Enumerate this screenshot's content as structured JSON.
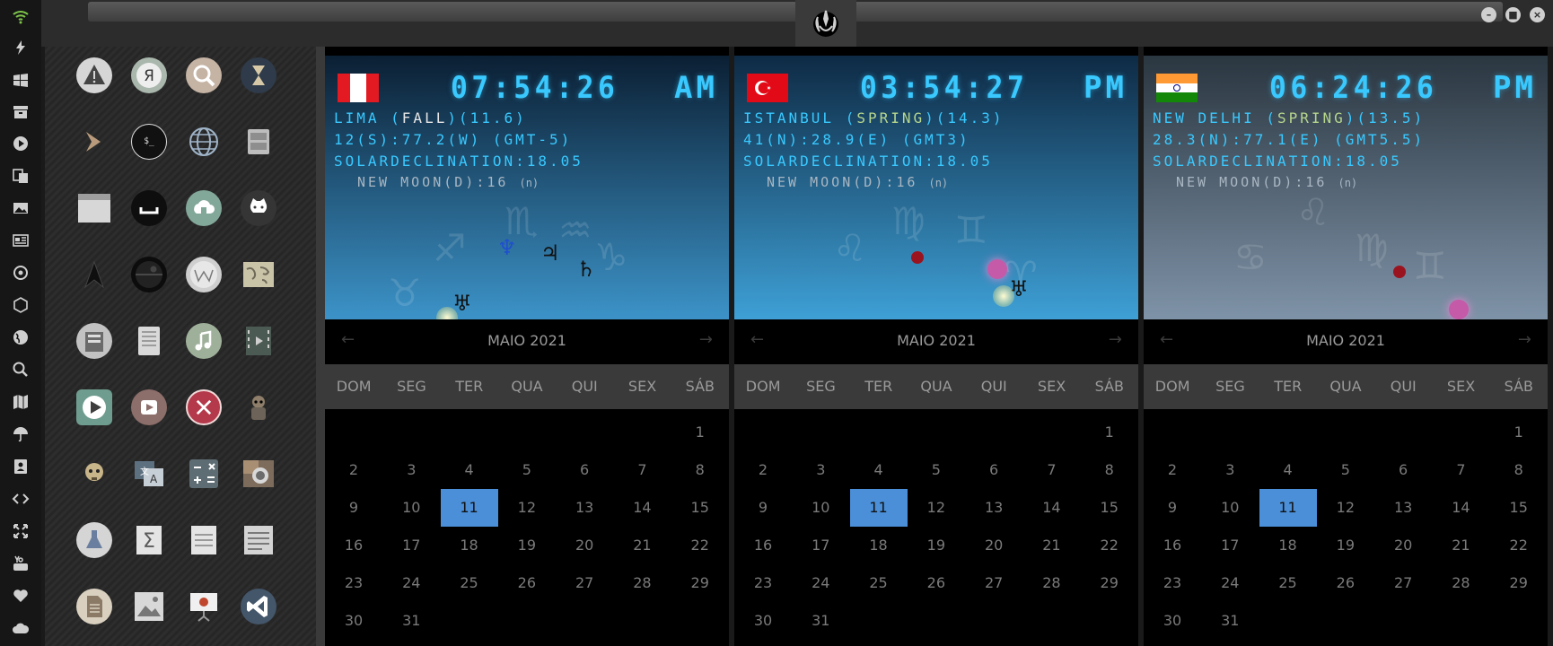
{
  "weekdays": [
    "DOM",
    "SEG",
    "TER",
    "QUA",
    "QUI",
    "SEX",
    "SÁB"
  ],
  "widgets": [
    {
      "clock": "07:54:26",
      "ampm": "AM",
      "line1": "LIMA (",
      "season": "FALL",
      "line1_end": ")(11.6)",
      "line2": "12(S):77.2(W) (GMT-5)",
      "line3": "SOLARDECLINATION:18.05",
      "moon": "NEW MOON(D):16",
      "moon_icon": "(n)",
      "month": "MAIO 2021",
      "sky_top": "#0b1f33",
      "sky_bottom": "#3c93c8"
    },
    {
      "clock": "03:54:27",
      "ampm": "PM",
      "line1": "ISTANBUL (",
      "season": "SPRING",
      "line1_end": ")(14.3)",
      "line2": "41(N):28.9(E) (GMT3)",
      "line3": "SOLARDECLINATION:18.05",
      "moon": "NEW MOON(D):16",
      "moon_icon": "(n)",
      "month": "MAIO 2021",
      "sky_top": "#0e2a44",
      "sky_bottom": "#3ea0d6"
    },
    {
      "clock": "06:24:26",
      "ampm": "PM",
      "line1": "NEW DELHI (",
      "season": "SPRING",
      "line1_end": ")(13.5)",
      "line2": "28.3(N):77.1(E) (GMT5.5)",
      "line3": "SOLARDECLINATION:18.05",
      "moon": "NEW MOON(D):16",
      "moon_icon": "(n)",
      "month": "MAIO 2021",
      "sky_top": "#2a3640",
      "sky_bottom": "#7f93a8"
    }
  ],
  "days": [
    "1",
    "2",
    "3",
    "4",
    "5",
    "6",
    "7",
    "8",
    "9",
    "10",
    "11",
    "12",
    "13",
    "14",
    "15",
    "16",
    "17",
    "18",
    "19",
    "20",
    "21",
    "22",
    "23",
    "24",
    "25",
    "26",
    "27",
    "28",
    "29",
    "30",
    "31"
  ],
  "today": "11",
  "colors": {
    "accent": "#4a8fd8",
    "clock": "#39c9ff"
  },
  "dock_icons": [
    "wifi-icon",
    "lightning-icon",
    "windows-icon",
    "archive-icon",
    "play-icon",
    "translate-icon",
    "image-icon",
    "news-icon",
    "settings-icon",
    "network-icon",
    "globe-icon",
    "search-icon",
    "map-icon",
    "umbrella-icon",
    "contacts-icon",
    "code-icon",
    "fullscreen-icon",
    "youtube-icon",
    "heart-icon",
    "cloud-icon"
  ],
  "window_buttons": [
    "minimize",
    "maximize",
    "close"
  ]
}
